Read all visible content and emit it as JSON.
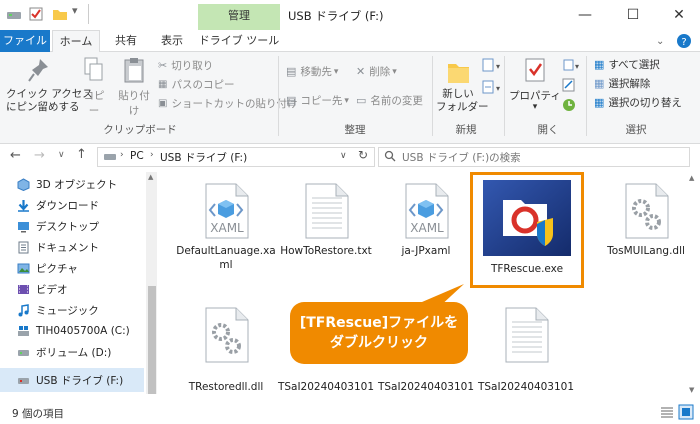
{
  "window": {
    "title": "USB ドライブ (F:)",
    "context_tab_group": "管理",
    "minimize": "—",
    "maximize": "☐",
    "close": "✕"
  },
  "ribbon_tabs": [
    "ファイル",
    "ホーム",
    "共有",
    "表示",
    "ドライブ ツール"
  ],
  "ribbon": {
    "clipboard": {
      "pin": "クイック アクセス\nにピン留めする",
      "copy": "コピー",
      "paste": "貼り付け",
      "cut": "切り取り",
      "copy_path": "パスのコピー",
      "paste_shortcut": "ショートカットの貼り付け",
      "group": "クリップボード"
    },
    "organize": {
      "move_to": "移動先",
      "delete": "削除",
      "copy_to": "コピー先",
      "rename": "名前の変更",
      "group": "整理"
    },
    "new": {
      "new_folder": "新しい\nフォルダー",
      "group": "新規"
    },
    "open": {
      "properties": "プロパティ",
      "group": "開く"
    },
    "select": {
      "select_all": "すべて選択",
      "select_none": "選択解除",
      "invert": "選択の切り替え",
      "group": "選択"
    }
  },
  "address": {
    "crumbs": [
      "PC",
      "USB ドライブ (F:)"
    ],
    "search_placeholder": "USB ドライブ (F:)の検索"
  },
  "nav_items": [
    {
      "label": "3D オブジェクト",
      "icon": "3d-objects-icon"
    },
    {
      "label": "ダウンロード",
      "icon": "download-icon"
    },
    {
      "label": "デスクトップ",
      "icon": "desktop-icon"
    },
    {
      "label": "ドキュメント",
      "icon": "documents-icon"
    },
    {
      "label": "ピクチャ",
      "icon": "pictures-icon"
    },
    {
      "label": "ビデオ",
      "icon": "videos-icon"
    },
    {
      "label": "ミュージック",
      "icon": "music-icon"
    },
    {
      "label": "TIH0405700A (C:)",
      "icon": "windows-drive-icon"
    },
    {
      "label": "ボリューム (D:)",
      "icon": "drive-icon"
    },
    {
      "label": "USB ドライブ (F:)",
      "icon": "usb-drive-icon"
    }
  ],
  "files": [
    {
      "name": "DefaultLanuage.xaml",
      "type": "xaml"
    },
    {
      "name": "HowToRestore.txt",
      "type": "txt"
    },
    {
      "name": "ja-JPxaml",
      "type": "xaml"
    },
    {
      "name": "TFRescue.exe",
      "type": "exe",
      "selected": true
    },
    {
      "name": "TosMUILang.dll",
      "type": "dll"
    },
    {
      "name": "TRestoredll.dll",
      "type": "dll"
    },
    {
      "name": "TSaI20240403101",
      "type": "txt"
    },
    {
      "name": "TSaI20240403101",
      "type": "txt"
    },
    {
      "name": "TSaI20240403101",
      "type": "txt"
    }
  ],
  "callout": {
    "line1": "[TFRescue]ファイルを",
    "line2": "ダブルクリック"
  },
  "status": {
    "item_count": "9 個の項目"
  },
  "colors": {
    "accent": "#1979ca",
    "highlight": "#f08a00",
    "context_tab": "#c4e6b4"
  }
}
